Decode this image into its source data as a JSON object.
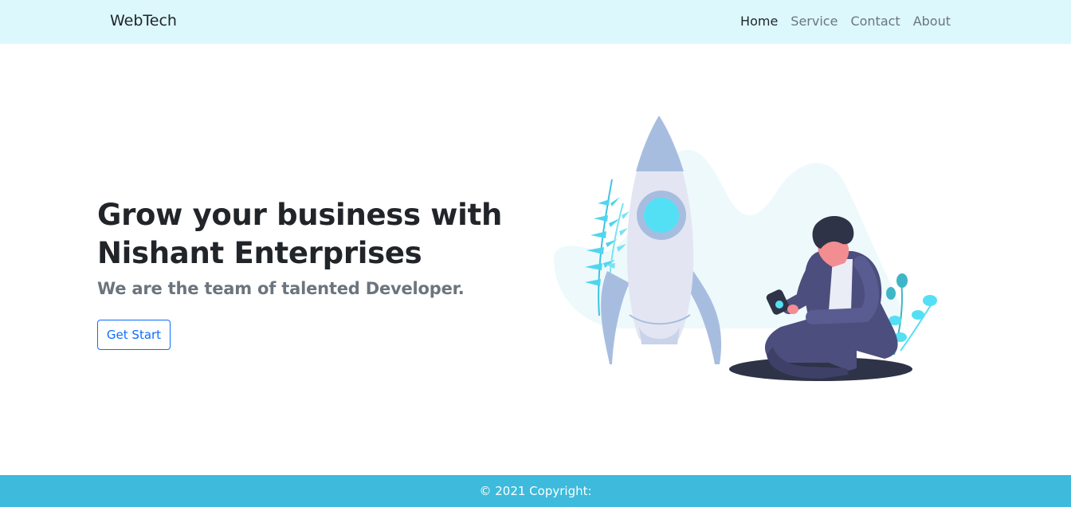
{
  "navbar": {
    "brand": "WebTech",
    "links": [
      {
        "label": "Home",
        "active": true
      },
      {
        "label": "Service",
        "active": false
      },
      {
        "label": "Contact",
        "active": false
      },
      {
        "label": "About",
        "active": false
      }
    ],
    "background": "#dcf8fd"
  },
  "hero": {
    "headline_line1": "Grow your business with",
    "headline_line2": "Nishant Enterprises",
    "subheadline": "We are the team of talented Developer.",
    "cta_label": "Get Start",
    "cta_color": "#0d6efd"
  },
  "illustration": {
    "icon": "rocket-and-person-illustration"
  },
  "footer": {
    "copyright": "© 2021 Copyright:",
    "background": "#3dbadc"
  }
}
